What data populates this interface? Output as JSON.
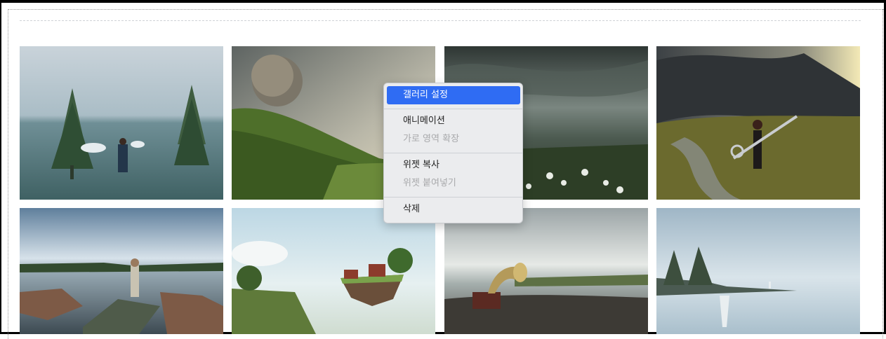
{
  "gallery": {
    "images": [
      {
        "name": "trees-in-lake"
      },
      {
        "name": "planet-over-valley"
      },
      {
        "name": "stormy-meadow"
      },
      {
        "name": "girl-with-scissors"
      },
      {
        "name": "man-on-broken-ice-boat"
      },
      {
        "name": "floating-island"
      },
      {
        "name": "gramophone-shore"
      },
      {
        "name": "misty-shore"
      }
    ]
  },
  "context_menu": {
    "items": [
      {
        "label": "갤러리 설정",
        "state": "highlighted"
      },
      {
        "label": "애니메이션",
        "state": "enabled"
      },
      {
        "label": "가로 영역 확장",
        "state": "disabled"
      },
      {
        "label": "위젯 복사",
        "state": "enabled"
      },
      {
        "label": "위젯 붙여넣기",
        "state": "disabled"
      },
      {
        "label": "삭제",
        "state": "enabled"
      }
    ],
    "colors": {
      "highlight": "#2f6cf3",
      "background": "#ebecee",
      "disabled_text": "#a8a9ab"
    }
  }
}
